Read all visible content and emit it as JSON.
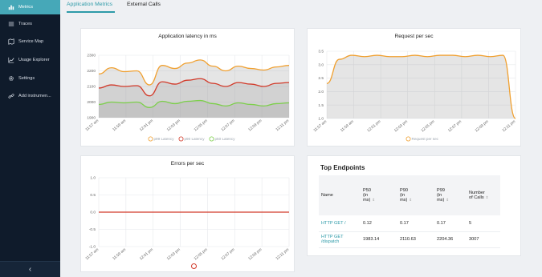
{
  "sidebar": {
    "items": [
      {
        "label": "Metrics",
        "icon": "bar-chart-icon",
        "active": true
      },
      {
        "label": "Traces",
        "icon": "list-icon",
        "active": false
      },
      {
        "label": "Service Map",
        "icon": "map-icon",
        "active": false
      },
      {
        "label": "Usage Explorer",
        "icon": "line-chart-icon",
        "active": false
      },
      {
        "label": "Settings",
        "icon": "gear-icon",
        "active": false
      },
      {
        "label": "Add instrumen...",
        "icon": "link-icon",
        "active": false
      }
    ],
    "collapse_icon": "chevron-left-icon",
    "colors": {
      "bg": "#0f1b2b",
      "active": "#46a8b8"
    }
  },
  "tabs": [
    {
      "label": "Application Metrics",
      "active": true
    },
    {
      "label": "External Calls",
      "active": false
    }
  ],
  "chart_data": [
    {
      "type": "area",
      "title": "Application latency in ms",
      "categories": [
        "11:57 am",
        "11:59 am",
        "12:01 pm",
        "12:03 pm",
        "12:05 pm",
        "12:07 pm",
        "12:09 pm",
        "12:11 pm"
      ],
      "ylim": [
        1900,
        2300
      ],
      "yticks": [
        1900,
        2000,
        2100,
        2200,
        2300
      ],
      "series": [
        {
          "name": "p99 Latency",
          "color": "#f0a030",
          "values": [
            2180,
            2220,
            2195,
            2200,
            2110,
            2235,
            2215,
            2250,
            2270,
            2230,
            2200,
            2230,
            2215,
            2205,
            2225,
            2235
          ]
        },
        {
          "name": "p90 Latency",
          "color": "#d23a2a",
          "values": [
            2090,
            2110,
            2100,
            2105,
            2040,
            2130,
            2115,
            2140,
            2150,
            2120,
            2100,
            2125,
            2115,
            2100,
            2120,
            2125
          ]
        },
        {
          "name": "p50 Latency",
          "color": "#7ccf4a",
          "values": [
            1985,
            2000,
            1995,
            2000,
            1965,
            2005,
            1990,
            2005,
            2010,
            1990,
            1975,
            1995,
            1985,
            1975,
            1990,
            1995
          ]
        }
      ],
      "grid": true,
      "legend": "bottom"
    },
    {
      "type": "area",
      "title": "Request per sec",
      "categories": [
        "11:57 am",
        "11:59 am",
        "12:01 pm",
        "12:03 pm",
        "12:05 pm",
        "12:07 pm",
        "12:09 pm",
        "12:11 pm"
      ],
      "ylim": [
        1.0,
        3.5
      ],
      "yticks": [
        1.0,
        1.5,
        2.0,
        2.5,
        3.0,
        3.5
      ],
      "series": [
        {
          "name": "Request per sec",
          "color": "#f0a030",
          "values": [
            2.3,
            3.2,
            3.35,
            3.3,
            3.35,
            3.3,
            3.3,
            3.35,
            3.3,
            3.35,
            3.35,
            3.3,
            3.35,
            3.3,
            3.35,
            1.0
          ]
        }
      ],
      "grid": true,
      "legend": "bottom"
    },
    {
      "type": "line",
      "title": "Errors per sec",
      "categories": [
        "11:57 am",
        "11:59 am",
        "12:01 pm",
        "12:03 pm",
        "12:05 pm",
        "12:07 pm",
        "12:09 pm",
        "12:11 pm"
      ],
      "ylim": [
        -1.0,
        1.0
      ],
      "yticks": [
        -1.0,
        -0.5,
        0,
        0.5,
        1.0
      ],
      "series": [
        {
          "name": "",
          "color": "#d23a2a",
          "values": [
            0,
            0,
            0,
            0,
            0,
            0,
            0,
            0,
            0,
            0,
            0,
            0,
            0,
            0,
            0,
            0
          ]
        }
      ],
      "grid": true,
      "legend": "bottom"
    }
  ],
  "endpoints": {
    "title": "Top Endpoints",
    "headers": [
      "Name",
      "P50\n(in\nms)",
      "P90\n(in\nms)",
      "P99\n(in\nms)",
      "Number\nof Calls"
    ],
    "rows": [
      {
        "name": "HTTP GET /",
        "p50": "0.12",
        "p90": "0.17",
        "p99": "0.17",
        "calls": "5"
      },
      {
        "name": "HTTP GET /dispatch",
        "p50": "1983.14",
        "p90": "2110.63",
        "p99": "2204.36",
        "calls": "3007"
      }
    ]
  }
}
